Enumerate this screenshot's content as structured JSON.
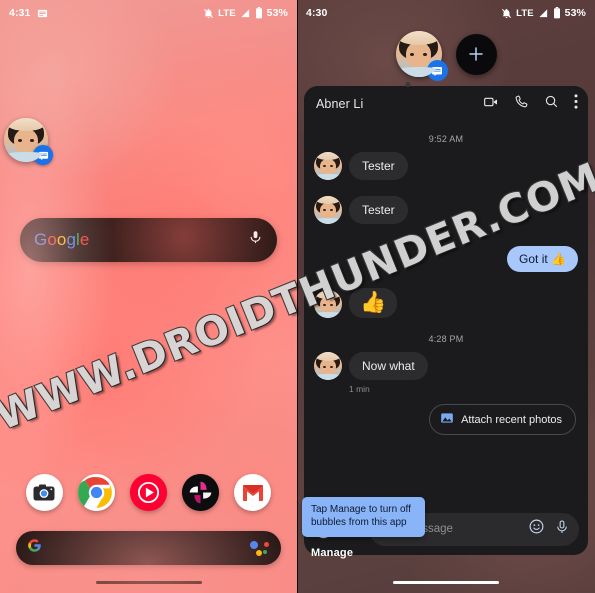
{
  "watermark": {
    "text": "WWW.DROIDTHUNDER.COM"
  },
  "left_panel": {
    "statusbar": {
      "time": "4:31",
      "notification_icon": "message-icon",
      "silent_icon": "bell-off-icon",
      "network_label": "LTE",
      "signal_icon": "signal-icon",
      "battery_icon": "battery-icon",
      "battery_level": "53%"
    },
    "floating_bubble": {
      "name": "Abner Li",
      "avatar_icon": "contact-avatar",
      "badge_icon": "messages-app-icon"
    },
    "search_widget": {
      "logo": {
        "g1": "G",
        "o1": "o",
        "o2": "o",
        "g2": "g",
        "l": "l",
        "e": "e"
      },
      "mic_icon": "microphone-icon"
    },
    "dock": {
      "apps": [
        {
          "label": "Camera",
          "icon": "camera-app-icon"
        },
        {
          "label": "Chrome",
          "icon": "chrome-app-icon"
        },
        {
          "label": "YouTube Music",
          "icon": "youtube-music-app-icon"
        },
        {
          "label": "Photos",
          "icon": "photos-app-icon"
        },
        {
          "label": "Gmail",
          "icon": "gmail-app-icon"
        }
      ]
    },
    "bottom_search": {
      "g_icon": "google-g-icon",
      "assistant_icon": "google-assistant-icon"
    },
    "nav_pill": "home-gesture-pill"
  },
  "right_panel": {
    "statusbar": {
      "time": "4:30",
      "silent_icon": "bell-off-icon",
      "network_label": "LTE",
      "signal_icon": "signal-icon",
      "battery_icon": "battery-icon",
      "battery_level": "53%"
    },
    "bubble_bar": {
      "active_bubble": {
        "name": "Abner Li",
        "avatar_icon": "contact-avatar",
        "badge_icon": "messages-app-icon"
      },
      "add_button": {
        "label": "+",
        "icon": "plus-icon"
      }
    },
    "chat": {
      "title": "Abner Li",
      "actions": [
        {
          "name": "video-call",
          "icon": "video-camera-icon"
        },
        {
          "name": "voice-call",
          "icon": "phone-icon"
        },
        {
          "name": "search",
          "icon": "search-icon"
        },
        {
          "name": "more-options",
          "icon": "overflow-menu-icon"
        }
      ],
      "timestamp_top": "9:52 AM",
      "timestamp_mid": "4:28 PM",
      "messages": [
        {
          "id": 1,
          "side": "in",
          "text": "Tester"
        },
        {
          "id": 2,
          "side": "in",
          "text": "Tester"
        },
        {
          "id": 3,
          "side": "out",
          "text": "Got it 👍"
        },
        {
          "id": 4,
          "side": "in",
          "text": "👍",
          "type": "emoji"
        },
        {
          "id": 5,
          "side": "in",
          "text": "Now what",
          "sub": "1 min"
        }
      ],
      "suggestion": {
        "label": "Attach recent photos",
        "icon": "photo-attach-icon"
      },
      "composer": {
        "placeholder": "Text message",
        "left_icons": [
          {
            "name": "camera-icon"
          },
          {
            "name": "gallery-icon"
          }
        ],
        "emoji_icon": "emoji-icon",
        "mic_icon": "microphone-icon"
      }
    },
    "tooltip": {
      "text": "Tap Manage to turn off bubbles from this app",
      "action_label": "Manage"
    },
    "nav_pill": "home-gesture-pill"
  },
  "colors": {
    "bubble_out": "#a8c7fa",
    "bubble_in": "#2c2c2e",
    "tooltip_bg": "#8ab4f8",
    "badge_blue": "#1a73e8",
    "chat_bg": "#1b1b1d"
  }
}
